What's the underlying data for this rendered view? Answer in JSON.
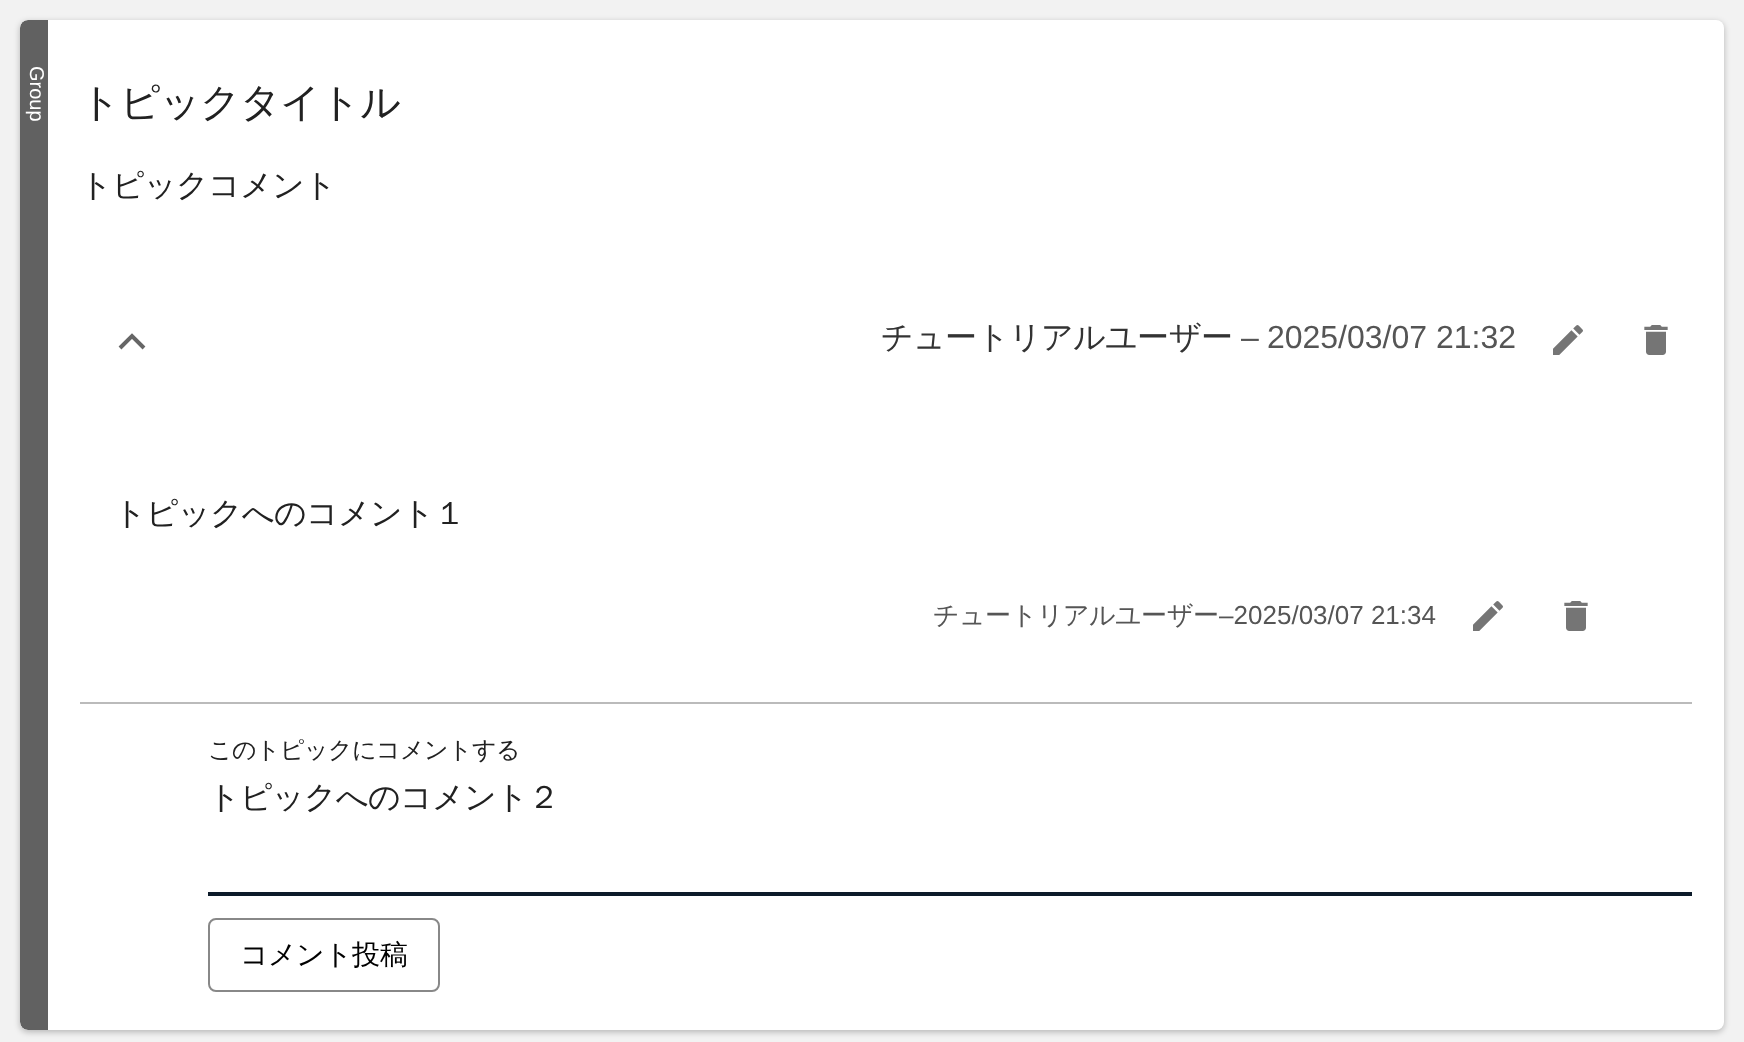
{
  "group_label": "Group",
  "topic": {
    "title": "トピックタイトル",
    "comment": "トピックコメント"
  },
  "thread": {
    "expanded": true,
    "author": "チュートリアルユーザー",
    "separator": "–",
    "date": "2025/03/07 21:32",
    "replies": [
      {
        "text": "トピックへのコメント１",
        "author": "チュートリアルユーザー",
        "separator": "–",
        "date": "2025/03/07 21:34"
      }
    ]
  },
  "comment_form": {
    "label": "このトピックにコメントする",
    "value": "トピックへのコメント２",
    "button": "コメント投稿"
  }
}
